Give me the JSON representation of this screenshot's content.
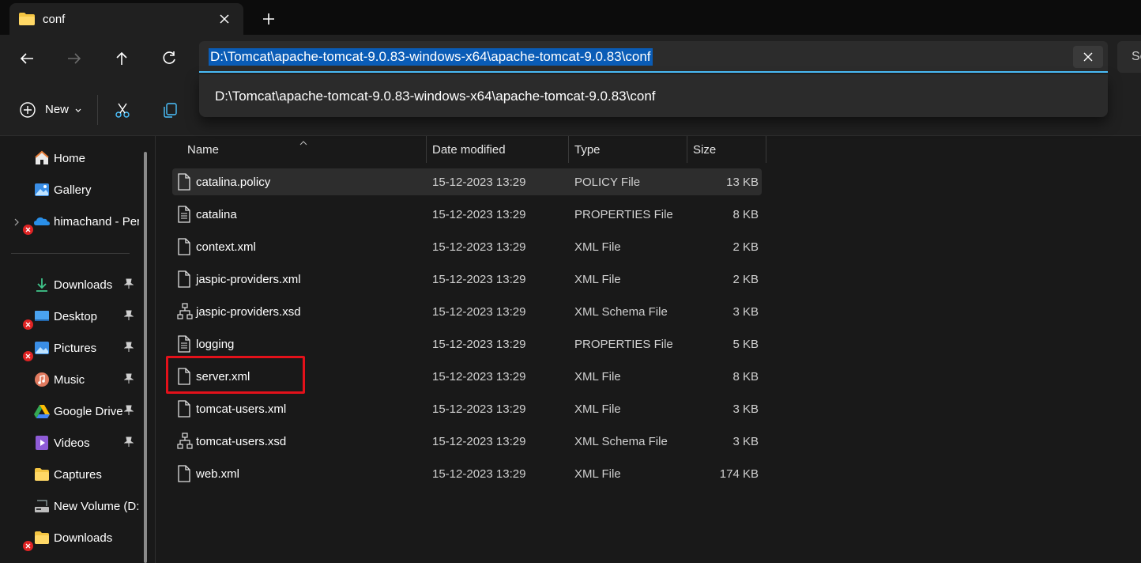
{
  "tab": {
    "title": "conf",
    "close_icon": "close-icon",
    "new_tab_label": "+"
  },
  "address_bar": {
    "path": "D:\\Tomcat\\apache-tomcat-9.0.83-windows-x64\\apache-tomcat-9.0.83\\conf",
    "suggestion": "D:\\Tomcat\\apache-tomcat-9.0.83-windows-x64\\apache-tomcat-9.0.83\\conf",
    "selection_color": "#0a5cb6",
    "focus_color": "#4cc2ff"
  },
  "search": {
    "partial_label": "Se"
  },
  "command_bar": {
    "new_label": "New"
  },
  "sidebar": {
    "items": [
      {
        "label": "Home",
        "icon": "home-icon"
      },
      {
        "label": "Gallery",
        "icon": "gallery-icon"
      },
      {
        "label": "himachand - Per",
        "icon": "onedrive-icon",
        "error": true,
        "expandable": true
      },
      {
        "label": "Downloads",
        "icon": "download-icon",
        "pinned": true
      },
      {
        "label": "Desktop",
        "icon": "desktop-icon",
        "pinned": true,
        "error": true
      },
      {
        "label": "Pictures",
        "icon": "pictures-icon",
        "pinned": true,
        "error": true
      },
      {
        "label": "Music",
        "icon": "music-icon",
        "pinned": true
      },
      {
        "label": "Google Drive",
        "icon": "google-drive-icon",
        "pinned": true
      },
      {
        "label": "Videos",
        "icon": "videos-icon",
        "pinned": true
      },
      {
        "label": "Captures",
        "icon": "folder-icon"
      },
      {
        "label": "New Volume (D:",
        "icon": "drive-icon"
      },
      {
        "label": "Downloads",
        "icon": "folder-icon",
        "error": true
      }
    ]
  },
  "file_list": {
    "columns": [
      "Name",
      "Date modified",
      "Type",
      "Size"
    ],
    "rows": [
      {
        "name": "catalina.policy",
        "date": "15-12-2023 13:29",
        "type": "POLICY File",
        "size": "13 KB",
        "icon": "file-icon"
      },
      {
        "name": "catalina",
        "date": "15-12-2023 13:29",
        "type": "PROPERTIES File",
        "size": "8 KB",
        "icon": "text-file-icon"
      },
      {
        "name": "context.xml",
        "date": "15-12-2023 13:29",
        "type": "XML File",
        "size": "2 KB",
        "icon": "file-icon"
      },
      {
        "name": "jaspic-providers.xml",
        "date": "15-12-2023 13:29",
        "type": "XML File",
        "size": "2 KB",
        "icon": "file-icon"
      },
      {
        "name": "jaspic-providers.xsd",
        "date": "15-12-2023 13:29",
        "type": "XML Schema File",
        "size": "3 KB",
        "icon": "schema-file-icon"
      },
      {
        "name": "logging",
        "date": "15-12-2023 13:29",
        "type": "PROPERTIES File",
        "size": "5 KB",
        "icon": "text-file-icon"
      },
      {
        "name": "server.xml",
        "date": "15-12-2023 13:29",
        "type": "XML File",
        "size": "8 KB",
        "icon": "file-icon",
        "highlighted": true
      },
      {
        "name": "tomcat-users.xml",
        "date": "15-12-2023 13:29",
        "type": "XML File",
        "size": "3 KB",
        "icon": "file-icon"
      },
      {
        "name": "tomcat-users.xsd",
        "date": "15-12-2023 13:29",
        "type": "XML Schema File",
        "size": "3 KB",
        "icon": "schema-file-icon"
      },
      {
        "name": "web.xml",
        "date": "15-12-2023 13:29",
        "type": "XML File",
        "size": "174 KB",
        "icon": "file-icon"
      }
    ],
    "highlight_color": "#e3111a"
  }
}
